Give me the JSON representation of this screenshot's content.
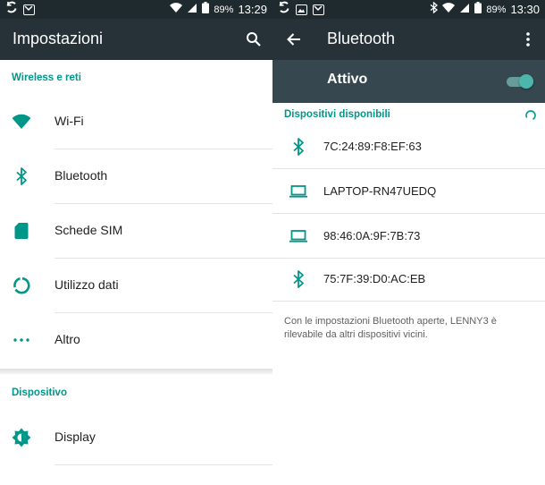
{
  "left": {
    "status": {
      "battery_pct": "89%",
      "time": "13:29"
    },
    "title": "Impostazioni",
    "sections": [
      {
        "header": "Wireless e reti",
        "items": [
          {
            "label": "Wi-Fi",
            "icon": "wifi-icon"
          },
          {
            "label": "Bluetooth",
            "icon": "bluetooth-icon"
          },
          {
            "label": "Schede SIM",
            "icon": "sim-card-icon"
          },
          {
            "label": "Utilizzo dati",
            "icon": "data-usage-icon"
          },
          {
            "label": "Altro",
            "icon": "more-icon"
          }
        ]
      },
      {
        "header": "Dispositivo",
        "items": [
          {
            "label": "Display",
            "icon": "brightness-icon"
          }
        ]
      }
    ]
  },
  "right": {
    "status": {
      "battery_pct": "89%",
      "time": "13:30"
    },
    "title": "Bluetooth",
    "master": {
      "label": "Attivo",
      "enabled": true
    },
    "available_header": "Dispositivi disponibili",
    "devices": [
      {
        "name": "7C:24:89:F8:EF:63",
        "icon": "bluetooth-icon"
      },
      {
        "name": "LAPTOP-RN47UEDQ",
        "icon": "laptop-icon"
      },
      {
        "name": "98:46:0A:9F:7B:73",
        "icon": "laptop-icon"
      },
      {
        "name": "75:7F:39:D0:AC:EB",
        "icon": "bluetooth-icon"
      }
    ],
    "visibility_note": "Con le impostazioni Bluetooth aperte, LENNY3 è rilevabile da altri dispositivi vicini."
  },
  "colors": {
    "accent": "#009688",
    "appbar": "#263238",
    "statusbar": "#1e2a2e",
    "master_bar": "#37474f"
  }
}
